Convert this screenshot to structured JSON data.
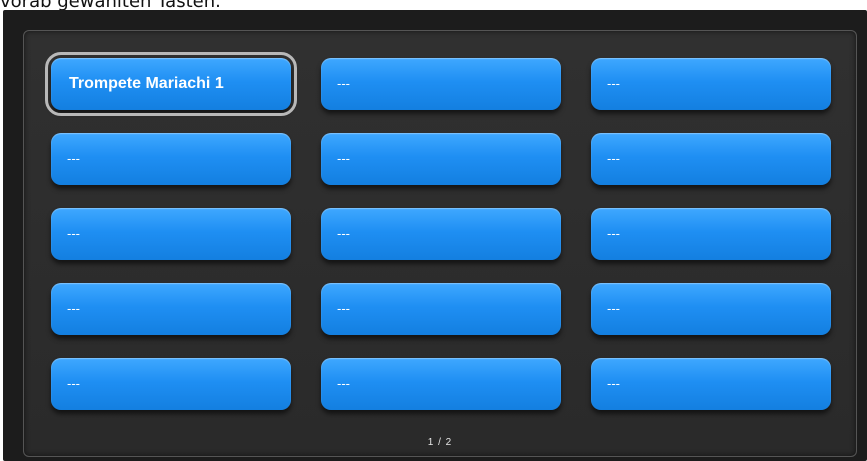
{
  "document": {
    "text": "vorab gewählten Tasten."
  },
  "panel": {
    "slots": [
      {
        "label": "Trompete Mariachi 1",
        "selected": true
      },
      {
        "label": "---"
      },
      {
        "label": "---"
      },
      {
        "label": "---"
      },
      {
        "label": "---"
      },
      {
        "label": "---"
      },
      {
        "label": "---"
      },
      {
        "label": "---"
      },
      {
        "label": "---"
      },
      {
        "label": "---"
      },
      {
        "label": "---"
      },
      {
        "label": "---"
      },
      {
        "label": "---"
      },
      {
        "label": "---"
      },
      {
        "label": "---"
      }
    ],
    "page_indicator": "1 / 2"
  },
  "colors": {
    "slot_blue": "#1f8ff3",
    "selected_outline": "#b8b8b8",
    "panel_background": "#2a2a2a"
  }
}
